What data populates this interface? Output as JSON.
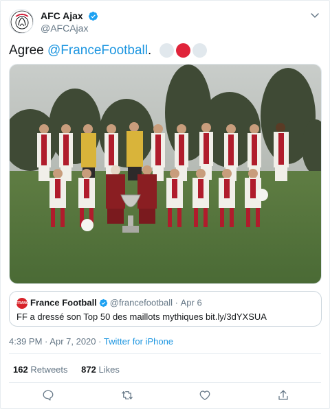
{
  "author": {
    "display_name": "AFC Ajax",
    "handle": "@AFCAjax",
    "avatar_icon": "ajax-crest-icon",
    "verified": true
  },
  "tweet": {
    "text_prefix": "Agree ",
    "mention": "@FranceFootball",
    "text_suffix": ".",
    "emoji_colors": [
      "#e1e8ed",
      "#e0243a",
      "#e1e8ed"
    ]
  },
  "media": {
    "kind": "photo"
  },
  "quoted": {
    "name": "France Football",
    "logo_text": "FRANCE FOOTBALL",
    "handle": "@francefootball",
    "separator": "·",
    "date": "Apr 6",
    "text": "FF a dressé son Top 50 des maillots mythiques bit.ly/3dYXSUA"
  },
  "meta": {
    "time": "4:39 PM",
    "separator": "·",
    "date": "Apr 7, 2020",
    "source": "Twitter for iPhone"
  },
  "stats": {
    "retweets_count": "162",
    "retweets_label": "Retweets",
    "likes_count": "872",
    "likes_label": "Likes"
  },
  "actions": [
    "reply-icon",
    "retweet-icon",
    "like-icon",
    "share-icon"
  ],
  "colors": {
    "link": "#1b95e0",
    "secondary_text": "#657786",
    "verified": "#1da1f2",
    "border": "#e6ecf0"
  }
}
